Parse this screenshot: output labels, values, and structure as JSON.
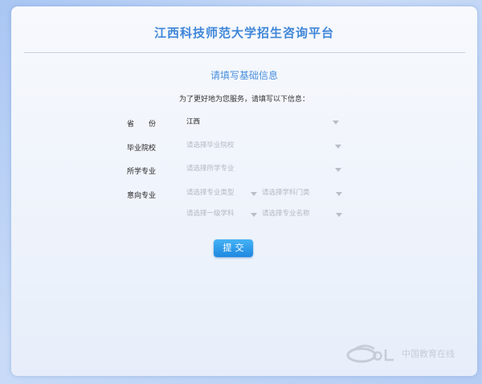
{
  "header": {
    "title": "江西科技师范大学招生咨询平台",
    "subtitle": "请填写基础信息",
    "intro": "为了更好地为您服务，请填写以下信息："
  },
  "form": {
    "province": {
      "label": "省　　份",
      "value": "江西"
    },
    "school": {
      "label": "毕业院校",
      "placeholder": "请选择毕业院校"
    },
    "major_studied": {
      "label": "所学专业",
      "placeholder": "请选择所学专业"
    },
    "intended_major": {
      "label": "意向专业",
      "type_placeholder": "请选择专业类型",
      "category_placeholder": "请选择学科门类",
      "primary_placeholder": "请选择一级学科",
      "name_placeholder": "请选择专业名称"
    },
    "submit_label": "提交"
  },
  "footer": {
    "brand": "中国教育在线",
    "logo_icon": "eol-logo-icon"
  },
  "colors": {
    "accent": "#3f86d8",
    "button": "#1e88e0"
  }
}
